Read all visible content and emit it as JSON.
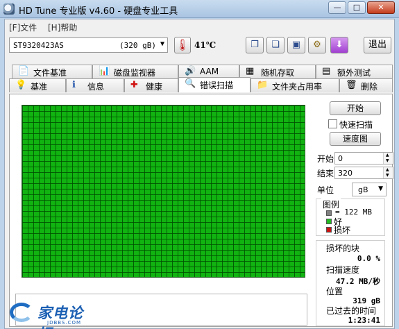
{
  "window": {
    "title": "HD Tune 专业版 v4.60 - 硬盘专业工具",
    "minimize_glyph": "—",
    "maximize_glyph": "□",
    "close_glyph": "✕"
  },
  "menu": {
    "file": "[F]文件",
    "help": "[H]帮助"
  },
  "toolbar": {
    "drive_name": "ST9320423AS",
    "drive_size": "(320 gB)",
    "temperature": "41℃",
    "exit_label": "退出",
    "icons": [
      "copy-text-icon",
      "copy-screenshot-icon",
      "save-icon",
      "options-icon",
      "download-icon"
    ]
  },
  "tabs": {
    "row1": [
      {
        "label": "文件基准",
        "icon": "file-benchmark-icon"
      },
      {
        "label": "磁盘监视器",
        "icon": "disk-monitor-icon"
      },
      {
        "label": "AAM",
        "icon": "speaker-icon"
      },
      {
        "label": "随机存取",
        "icon": "random-access-icon"
      },
      {
        "label": "额外测试",
        "icon": "extra-tests-icon"
      }
    ],
    "row2": [
      {
        "label": "基准",
        "icon": "lightbulb-icon"
      },
      {
        "label": "信息",
        "icon": "info-icon"
      },
      {
        "label": "健康",
        "icon": "health-cross-icon"
      },
      {
        "label": "错误扫描",
        "icon": "magnifier-icon",
        "active": true
      },
      {
        "label": "文件夹占用率",
        "icon": "folder-icon"
      },
      {
        "label": "删除",
        "icon": "trash-icon"
      }
    ]
  },
  "error_scan": {
    "start_button": "开始",
    "quick_scan_label": "快速扫描",
    "quick_scan_checked": false,
    "speed_map_button": "速度图",
    "start_label": "开始",
    "start_value": "0",
    "end_label": "结束",
    "end_value": "320",
    "unit_label": "单位",
    "unit_value": "gB",
    "legend": {
      "title": "图例",
      "block_size": "= 122 MB",
      "good": "好",
      "damaged": "损坏",
      "colors": {
        "block": "#808080",
        "good": "#22bb22",
        "damaged": "#cc1111"
      }
    },
    "stats": {
      "damaged_blocks_label": "损坏的块",
      "damaged_blocks_value": "0.0 %",
      "scan_speed_label": "扫描速度",
      "scan_speed_value": "47.2 MB/秒",
      "position_label": "位置",
      "position_value": "319 gB",
      "elapsed_label": "已过去的时间",
      "elapsed_value": "1:23:41"
    },
    "grid_color": "#11b311"
  },
  "watermark": {
    "text": "家电论坛",
    "sub": "JDBBS.COM"
  }
}
